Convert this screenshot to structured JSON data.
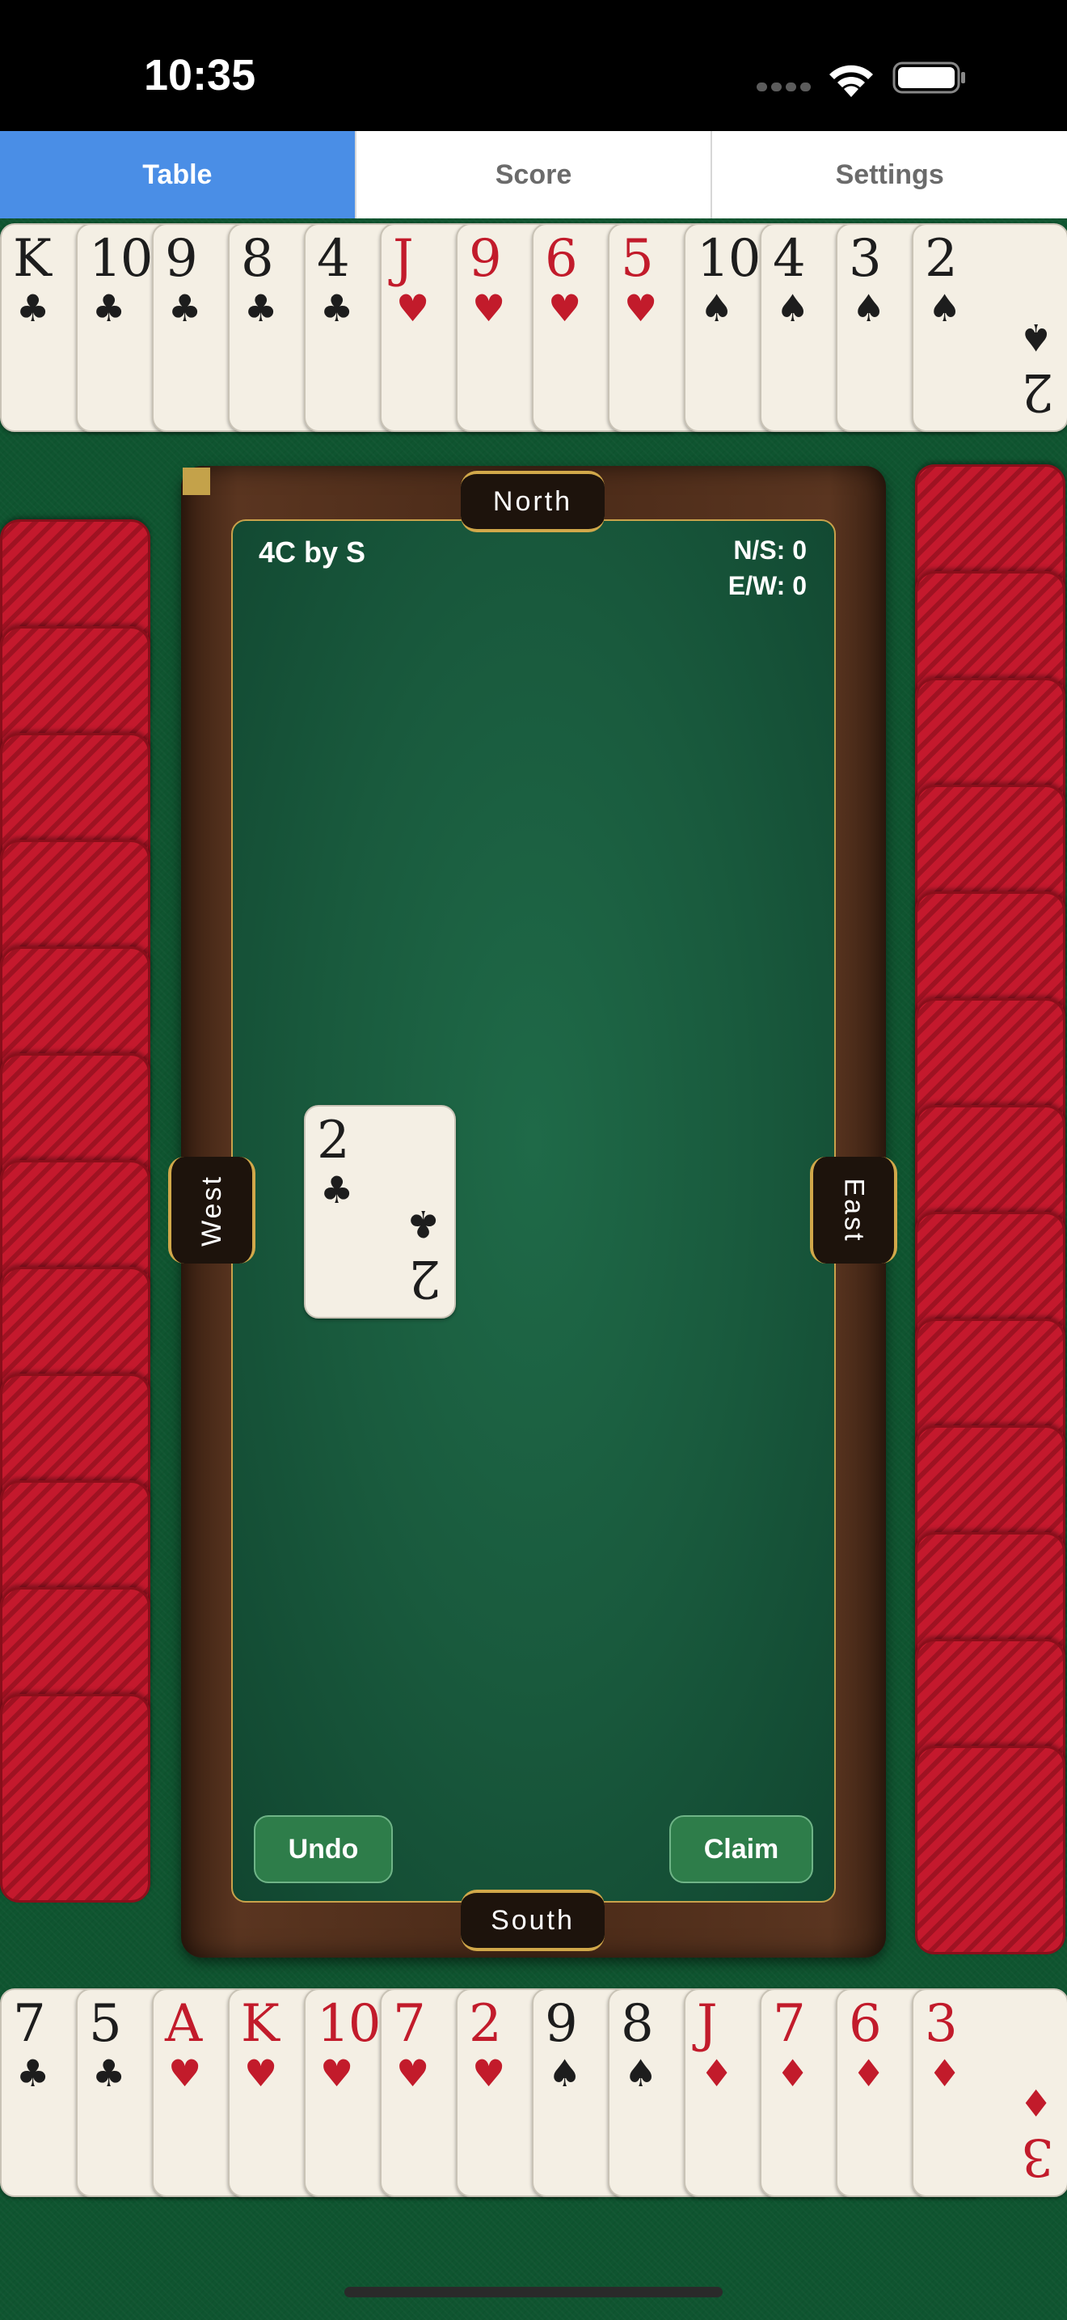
{
  "status_bar": {
    "time": "10:35"
  },
  "tabs": [
    {
      "label": "Table",
      "active": true
    },
    {
      "label": "Score",
      "active": false
    },
    {
      "label": "Settings",
      "active": false
    }
  ],
  "north_hand": [
    {
      "rank": "K",
      "suit": "♣",
      "color": "black"
    },
    {
      "rank": "10",
      "suit": "♣",
      "color": "black"
    },
    {
      "rank": "9",
      "suit": "♣",
      "color": "black"
    },
    {
      "rank": "8",
      "suit": "♣",
      "color": "black"
    },
    {
      "rank": "4",
      "suit": "♣",
      "color": "black"
    },
    {
      "rank": "J",
      "suit": "♥",
      "color": "red"
    },
    {
      "rank": "9",
      "suit": "♥",
      "color": "red"
    },
    {
      "rank": "6",
      "suit": "♥",
      "color": "red"
    },
    {
      "rank": "5",
      "suit": "♥",
      "color": "red"
    },
    {
      "rank": "10",
      "suit": "♠",
      "color": "black"
    },
    {
      "rank": "4",
      "suit": "♠",
      "color": "black"
    },
    {
      "rank": "3",
      "suit": "♠",
      "color": "black"
    },
    {
      "rank": "2",
      "suit": "♠",
      "color": "black"
    }
  ],
  "south_hand": [
    {
      "rank": "7",
      "suit": "♣",
      "color": "black"
    },
    {
      "rank": "5",
      "suit": "♣",
      "color": "black"
    },
    {
      "rank": "A",
      "suit": "♥",
      "color": "red"
    },
    {
      "rank": "K",
      "suit": "♥",
      "color": "red"
    },
    {
      "rank": "10",
      "suit": "♥",
      "color": "red"
    },
    {
      "rank": "7",
      "suit": "♥",
      "color": "red"
    },
    {
      "rank": "2",
      "suit": "♥",
      "color": "red"
    },
    {
      "rank": "9",
      "suit": "♠",
      "color": "black"
    },
    {
      "rank": "8",
      "suit": "♠",
      "color": "black"
    },
    {
      "rank": "J",
      "suit": "♦",
      "color": "red"
    },
    {
      "rank": "7",
      "suit": "♦",
      "color": "red"
    },
    {
      "rank": "6",
      "suit": "♦",
      "color": "red"
    },
    {
      "rank": "3",
      "suit": "♦",
      "color": "red"
    }
  ],
  "west_card_count": 12,
  "east_card_count": 13,
  "seats": {
    "north": "North",
    "south": "South",
    "west": "West",
    "east": "East"
  },
  "contract": "4C by S",
  "score": {
    "ns": "N/S: 0",
    "ew": "E/W: 0"
  },
  "played_card": {
    "rank": "2",
    "suit": "♣",
    "color": "black"
  },
  "buttons": {
    "undo": "Undo",
    "claim": "Claim"
  },
  "colors": {
    "felt": "#0f5530",
    "tab_active": "#4a8ee6",
    "card_back": "#c4192d",
    "gold_trim": "#d1a84a",
    "action_button": "#2e7d4a"
  }
}
